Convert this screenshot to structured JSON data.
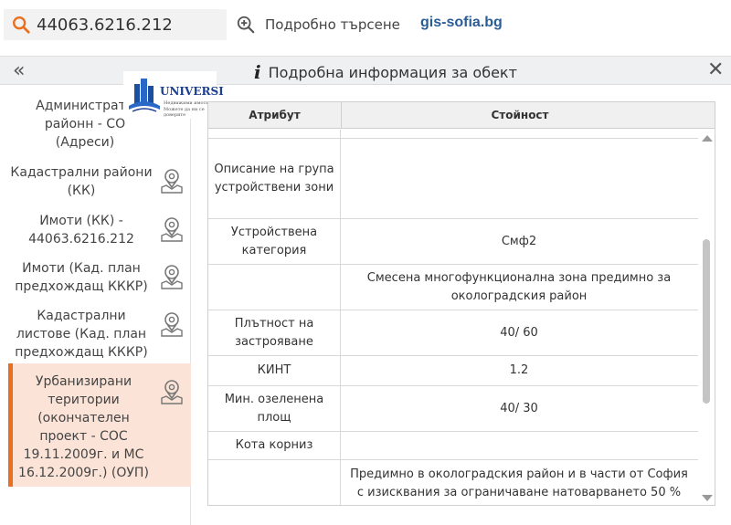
{
  "search": {
    "value": "44063.6216.212"
  },
  "advanced_search": {
    "label": "Подробно търсене"
  },
  "brand": "gis-sofia.bg",
  "panel": {
    "title": "Подробна информация за обект",
    "collapse": "«",
    "close": "✕"
  },
  "logo": {
    "text": "UNIVERSI",
    "sub1": "Недвижими имоти",
    "sub2": "Можете да ни се доверите"
  },
  "layers": [
    {
      "label": "Администрати районн - СО (Адреси)"
    },
    {
      "label": "Кадастрални райони (КК)"
    },
    {
      "label": "Имоти (КК) - 44063.6216.212"
    },
    {
      "label": "Имоти (Кад. план предхождащ КККР)"
    },
    {
      "label": "Кадастрални листове (Кад. план предхождащ КККР)"
    },
    {
      "label": "Урбанизирани територии (окончателен проект - СОС 19.11.2009г. и МС 16.12.2009г.) (ОУП)",
      "active": true
    }
  ],
  "table": {
    "headers": {
      "attribute": "Атрибут",
      "value": "Стойност"
    },
    "rows": [
      {
        "attr": "Описание на група устройствени зони",
        "value": ""
      },
      {
        "attr": "Устройствена категория",
        "value": "Смф2"
      },
      {
        "attr": "",
        "value": "Смесена многофункционална зона предимно за околоградския район"
      },
      {
        "attr": "Плътност на застрояване",
        "value": "40/ 60"
      },
      {
        "attr": "КИНТ",
        "value": "1.2"
      },
      {
        "attr": "Мин. озеленена площ",
        "value": "40/ 30"
      },
      {
        "attr": "Кота корниз",
        "value": ""
      },
      {
        "attr": "",
        "value": "Предимно в околоградския район и в части от София с изисквания за ограничаване натоварването 50 %"
      }
    ]
  },
  "colors": {
    "accent": "#e8701e",
    "active_bg": "#fbe4d7",
    "brand": "#2b5d95"
  }
}
